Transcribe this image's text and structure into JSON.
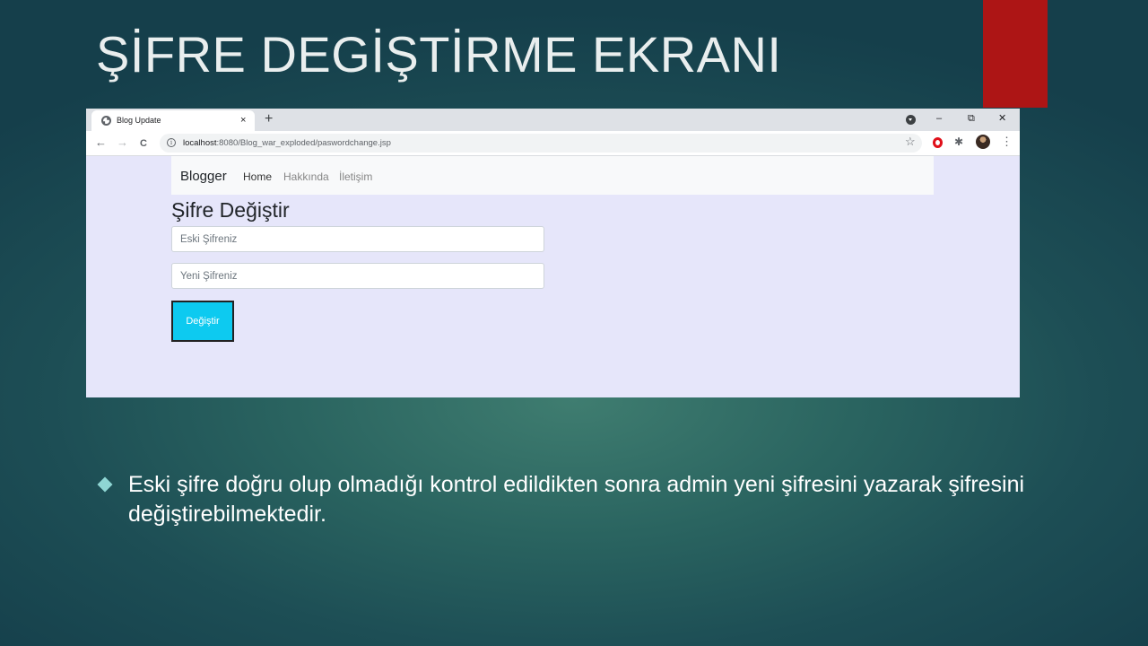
{
  "slide": {
    "title": "ŞİFRE DEGİŞTİRME EKRANI",
    "bullet": "Eski şifre doğru olup olmadığı kontrol edildikten sonra admin yeni şifresini yazarak şifresini değiştirebilmektedir.",
    "accent_color": "#ad1515"
  },
  "browser": {
    "tab_title": "Blog Update",
    "tab_close": "×",
    "new_tab": "+",
    "url_host": "localhost",
    "url_path": ":8080/Blog_war_exploded/paswordchange.jsp",
    "controls": {
      "minimize": "–",
      "restore": "⧉",
      "close": "✕"
    },
    "nav": {
      "back": "←",
      "forward": "→",
      "reload": "C"
    },
    "icons": {
      "star": "☆",
      "puzzle": "✱",
      "menu": "⋮",
      "info": "i"
    }
  },
  "page": {
    "brand": "Blogger",
    "nav_items": [
      "Home",
      "Hakkında",
      "İletişim"
    ],
    "heading": "Şifre Değiştir",
    "old_password_placeholder": "Eski Şifreniz",
    "new_password_placeholder": "Yeni Şifreniz",
    "submit_label": "Değiştir",
    "button_color": "#0dcaf0",
    "background_color": "#e6e6fa"
  }
}
